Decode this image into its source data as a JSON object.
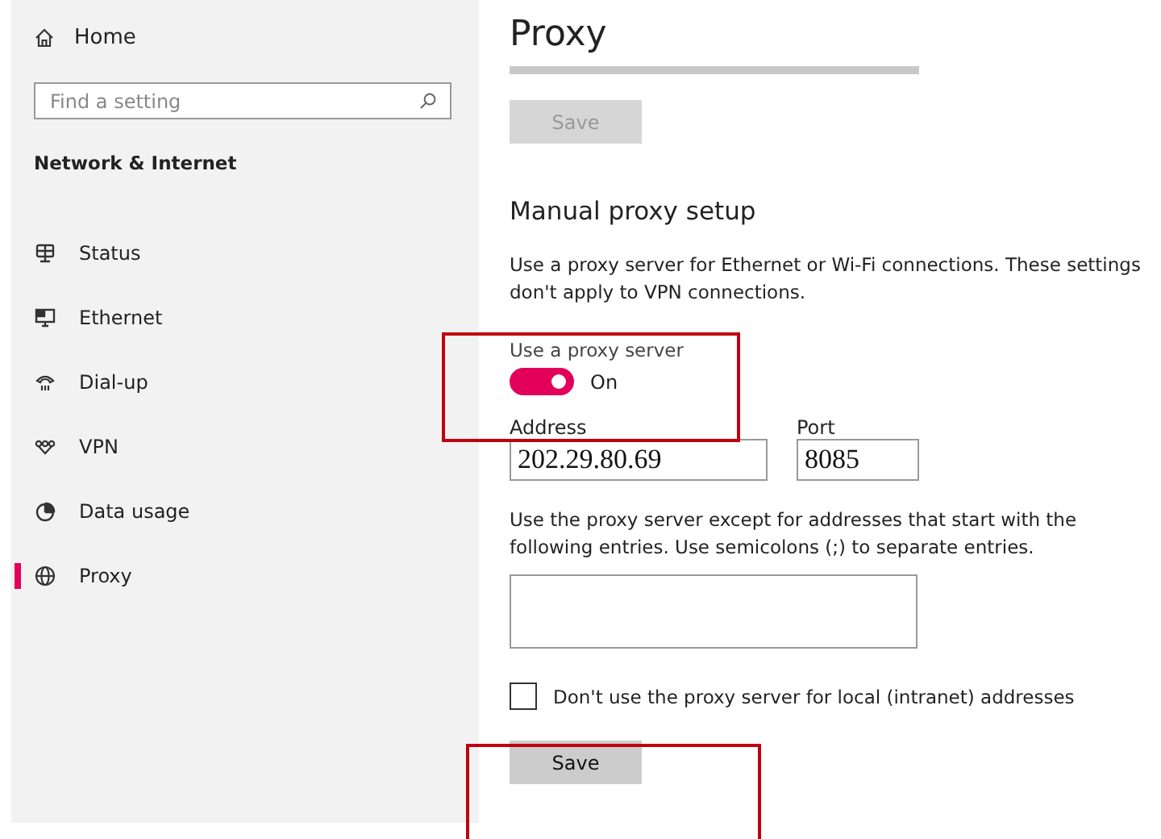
{
  "sidebar": {
    "home": "Home",
    "search": {
      "placeholder": "Find a setting"
    },
    "section": "Network & Internet",
    "items": [
      {
        "label": "Status",
        "kind": "status",
        "selected": false
      },
      {
        "label": "Ethernet",
        "kind": "ethernet",
        "selected": false
      },
      {
        "label": "Dial-up",
        "kind": "dialup",
        "selected": false
      },
      {
        "label": "VPN",
        "kind": "vpn",
        "selected": false
      },
      {
        "label": "Data usage",
        "kind": "data",
        "selected": false
      },
      {
        "label": "Proxy",
        "kind": "proxy",
        "selected": true
      }
    ]
  },
  "page": {
    "title": "Proxy",
    "top_save": {
      "label": "Save",
      "disabled": true
    },
    "heading": "Manual proxy setup",
    "description": "Use a proxy server for Ethernet or Wi-Fi connections. These settings don't apply to VPN connections.",
    "toggle": {
      "label": "Use a proxy server",
      "on": true,
      "state": "On",
      "highlighted": true
    },
    "address": {
      "label": "Address",
      "value": "202.29.80.69"
    },
    "port": {
      "label": "Port",
      "value": "8085"
    },
    "exceptions_text": "Use the proxy server except for addresses that start with the following entries. Use semicolons (;) to separate entries.",
    "local": {
      "label": "Don't use the proxy server for local (intranet) addresses",
      "checked": false
    },
    "save": {
      "label": "Save",
      "disabled": false,
      "highlighted": true
    }
  }
}
